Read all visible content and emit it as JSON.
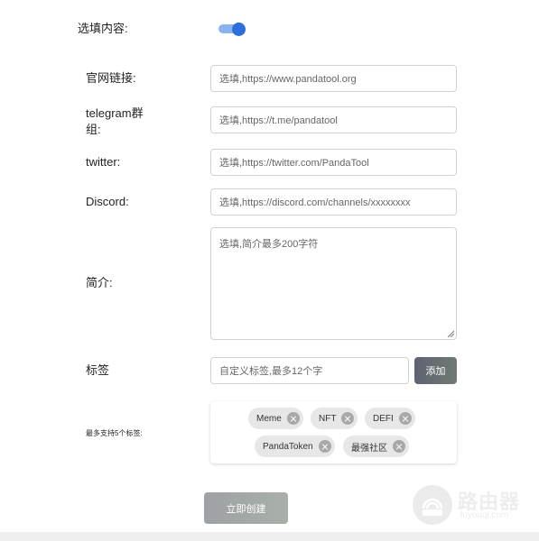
{
  "form": {
    "optional_label": "选填内容:",
    "optional_toggle_on": true,
    "website": {
      "label": "官网链接:",
      "placeholder": "选填,https://www.pandatool.org"
    },
    "telegram": {
      "label_line1": "telegram群",
      "label_line2": "组:",
      "placeholder": "选填,https://t.me/pandatool"
    },
    "twitter": {
      "label": "twitter:",
      "placeholder": "选填,https://twitter.com/PandaTool"
    },
    "discord": {
      "label": "Discord:",
      "placeholder": "选填,https://discord.com/channels/xxxxxxxx"
    },
    "intro": {
      "label": "简介:",
      "placeholder": "选填,简介最多200字符"
    },
    "tags": {
      "label": "标签",
      "placeholder": "自定义标签,最多12个字",
      "add_label": "添加",
      "support_label": "最多支持5个标签:",
      "items": [
        "Meme",
        "NFT",
        "DEFI",
        "PandaToken",
        "最强社区"
      ]
    },
    "submit_label": "立即创建"
  },
  "watermark": {
    "title": "路由器",
    "subtitle": "luyouqi.com"
  },
  "colors": {
    "toggle_knob": "#2b6fdc",
    "toggle_track": "#8ab4ef",
    "tag_bg": "#e7e7e7"
  }
}
